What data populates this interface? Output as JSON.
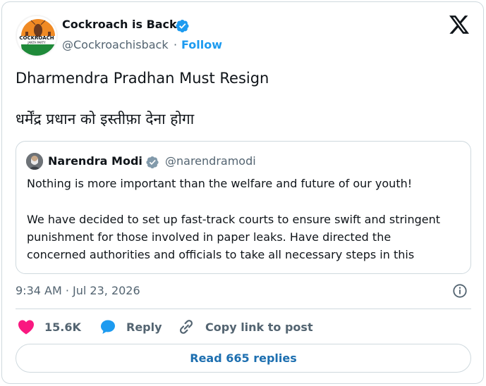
{
  "colors": {
    "accent": "#1d9bf0",
    "like": "#f91880",
    "muted": "#536471",
    "text": "#0f1419",
    "border": "#cfd9de",
    "avatar_orange": "#f08a24",
    "avatar_green": "#1f8a3a"
  },
  "author": {
    "name": "Cockroach is Back",
    "handle": "@Cockroachisback",
    "separator": "·",
    "follow_label": "Follow",
    "avatar_text_top": "COCKROACH",
    "avatar_text_bottom": "JANTA PARTY",
    "verified_icon": "verified-badge-icon"
  },
  "brand_icon": "x-logo-icon",
  "tweet": {
    "text_en": "Dharmendra Pradhan Must Resign",
    "text_hi": "धर्मेंद्र प्रधान को इस्तीफ़ा देना होगा"
  },
  "quote": {
    "name": "Narendra Modi",
    "handle": "@narendramodi",
    "lines": [
      "Nothing is more important than the welfare and future of our youth!",
      "",
      "We have decided to set up fast-track courts to ensure swift and stringent",
      "punishment for those involved in paper leaks. Have directed the",
      "concerned authorities and officials to take all necessary steps in this"
    ]
  },
  "meta": {
    "timestamp": "9:34 AM · Jul 23, 2026",
    "info_icon": "info-icon"
  },
  "actions": {
    "like_count": "15.6K",
    "reply_label": "Reply",
    "copy_label": "Copy link to post"
  },
  "replies_button_label": "Read 665 replies"
}
